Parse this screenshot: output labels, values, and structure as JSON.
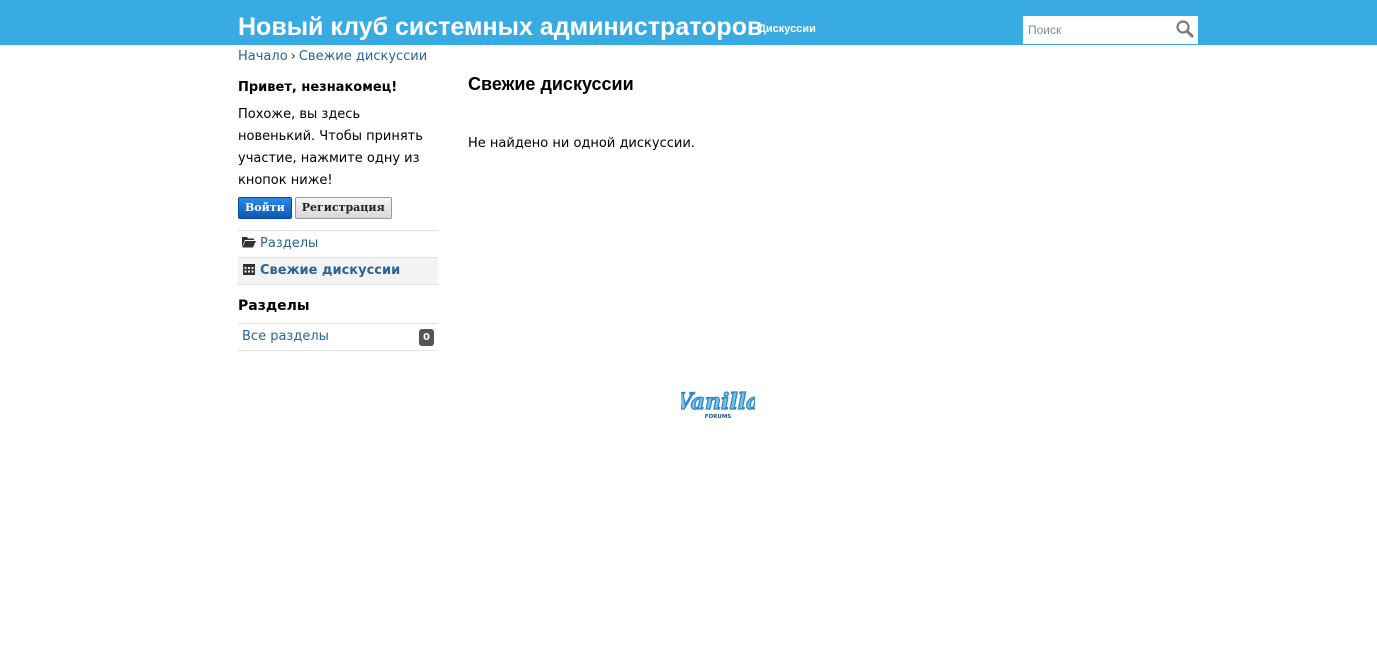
{
  "header": {
    "site_title": "Новый клуб системных администраторов",
    "nav_link": "Дискуссии",
    "search_placeholder": "Поиск",
    "icons": {
      "search": "search-icon"
    },
    "colors": {
      "bar": "#38abe3",
      "link": "#2a6496"
    }
  },
  "breadcrumbs": {
    "home": "Начало",
    "separator": "›",
    "current": "Свежие дискуссии"
  },
  "guest_box": {
    "title": "Привет, незнакомец!",
    "text": "Похоже, вы здесь новенький. Чтобы принять участие, нажмите одну из кнопок ниже!",
    "signin_label": "Войти",
    "register_label": "Регистрация"
  },
  "filters": [
    {
      "label": "Разделы",
      "icon": "folder-open-icon",
      "active": false
    },
    {
      "label": "Свежие дискуссии",
      "icon": "calendar-icon",
      "active": true
    }
  ],
  "categories": {
    "heading": "Разделы",
    "items": [
      {
        "label": "Все разделы",
        "count": "0"
      }
    ]
  },
  "main": {
    "title": "Свежие дискуссии",
    "empty_message": "Не найдено ни одной дискуссии."
  },
  "footer": {
    "logo_text": "Vanilla",
    "logo_subtext": "FORUMS",
    "logo_icon": "vanilla-forums-logo"
  }
}
